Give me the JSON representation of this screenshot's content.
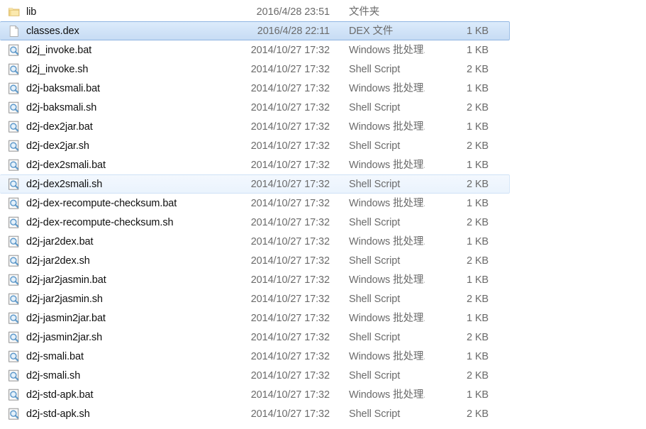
{
  "window": {
    "view": "details-list",
    "selected_index": 1,
    "hover_index": 10
  },
  "colors": {
    "background": "#ffffff",
    "selection_fill_top": "#dcebfb",
    "selection_fill_bottom": "#c7dcf4",
    "selection_border": "#8fb5e2",
    "hover_fill": "#eaf3fd",
    "hover_border": "#cfe2f6",
    "name_text": "#101010",
    "meta_text": "#6b6b6b",
    "folder_icon": "#f5d882",
    "magnifier_icon": "#6ba3d6"
  },
  "files": [
    {
      "name": "lib",
      "date": "2016/4/28 23:51",
      "type": "文件夹",
      "size": "",
      "icon": "folder-icon",
      "state": "normal"
    },
    {
      "name": "classes.dex",
      "date": "2016/4/28 22:11",
      "type": "DEX 文件",
      "size": "1 KB",
      "icon": "document-icon",
      "state": "selected"
    },
    {
      "name": "d2j_invoke.bat",
      "date": "2014/10/27 17:32",
      "type": "Windows 批处理...",
      "size": "1 KB",
      "icon": "unknown-file-icon",
      "state": "normal"
    },
    {
      "name": "d2j_invoke.sh",
      "date": "2014/10/27 17:32",
      "type": "Shell Script",
      "size": "2 KB",
      "icon": "unknown-file-icon",
      "state": "normal"
    },
    {
      "name": "d2j-baksmali.bat",
      "date": "2014/10/27 17:32",
      "type": "Windows 批处理...",
      "size": "1 KB",
      "icon": "unknown-file-icon",
      "state": "normal"
    },
    {
      "name": "d2j-baksmali.sh",
      "date": "2014/10/27 17:32",
      "type": "Shell Script",
      "size": "2 KB",
      "icon": "unknown-file-icon",
      "state": "normal"
    },
    {
      "name": "d2j-dex2jar.bat",
      "date": "2014/10/27 17:32",
      "type": "Windows 批处理...",
      "size": "1 KB",
      "icon": "unknown-file-icon",
      "state": "normal"
    },
    {
      "name": "d2j-dex2jar.sh",
      "date": "2014/10/27 17:32",
      "type": "Shell Script",
      "size": "2 KB",
      "icon": "unknown-file-icon",
      "state": "normal"
    },
    {
      "name": "d2j-dex2smali.bat",
      "date": "2014/10/27 17:32",
      "type": "Windows 批处理...",
      "size": "1 KB",
      "icon": "unknown-file-icon",
      "state": "normal"
    },
    {
      "name": "d2j-dex2smali.sh",
      "date": "2014/10/27 17:32",
      "type": "Shell Script",
      "size": "2 KB",
      "icon": "unknown-file-icon",
      "state": "hover"
    },
    {
      "name": "d2j-dex-recompute-checksum.bat",
      "date": "2014/10/27 17:32",
      "type": "Windows 批处理...",
      "size": "1 KB",
      "icon": "unknown-file-icon",
      "state": "normal"
    },
    {
      "name": "d2j-dex-recompute-checksum.sh",
      "date": "2014/10/27 17:32",
      "type": "Shell Script",
      "size": "2 KB",
      "icon": "unknown-file-icon",
      "state": "normal"
    },
    {
      "name": "d2j-jar2dex.bat",
      "date": "2014/10/27 17:32",
      "type": "Windows 批处理...",
      "size": "1 KB",
      "icon": "unknown-file-icon",
      "state": "normal"
    },
    {
      "name": "d2j-jar2dex.sh",
      "date": "2014/10/27 17:32",
      "type": "Shell Script",
      "size": "2 KB",
      "icon": "unknown-file-icon",
      "state": "normal"
    },
    {
      "name": "d2j-jar2jasmin.bat",
      "date": "2014/10/27 17:32",
      "type": "Windows 批处理...",
      "size": "1 KB",
      "icon": "unknown-file-icon",
      "state": "normal"
    },
    {
      "name": "d2j-jar2jasmin.sh",
      "date": "2014/10/27 17:32",
      "type": "Shell Script",
      "size": "2 KB",
      "icon": "unknown-file-icon",
      "state": "normal"
    },
    {
      "name": "d2j-jasmin2jar.bat",
      "date": "2014/10/27 17:32",
      "type": "Windows 批处理...",
      "size": "1 KB",
      "icon": "unknown-file-icon",
      "state": "normal"
    },
    {
      "name": "d2j-jasmin2jar.sh",
      "date": "2014/10/27 17:32",
      "type": "Shell Script",
      "size": "2 KB",
      "icon": "unknown-file-icon",
      "state": "normal"
    },
    {
      "name": "d2j-smali.bat",
      "date": "2014/10/27 17:32",
      "type": "Windows 批处理...",
      "size": "1 KB",
      "icon": "unknown-file-icon",
      "state": "normal"
    },
    {
      "name": "d2j-smali.sh",
      "date": "2014/10/27 17:32",
      "type": "Shell Script",
      "size": "2 KB",
      "icon": "unknown-file-icon",
      "state": "normal"
    },
    {
      "name": "d2j-std-apk.bat",
      "date": "2014/10/27 17:32",
      "type": "Windows 批处理...",
      "size": "1 KB",
      "icon": "unknown-file-icon",
      "state": "normal"
    },
    {
      "name": "d2j-std-apk.sh",
      "date": "2014/10/27 17:32",
      "type": "Shell Script",
      "size": "2 KB",
      "icon": "unknown-file-icon",
      "state": "normal"
    }
  ]
}
